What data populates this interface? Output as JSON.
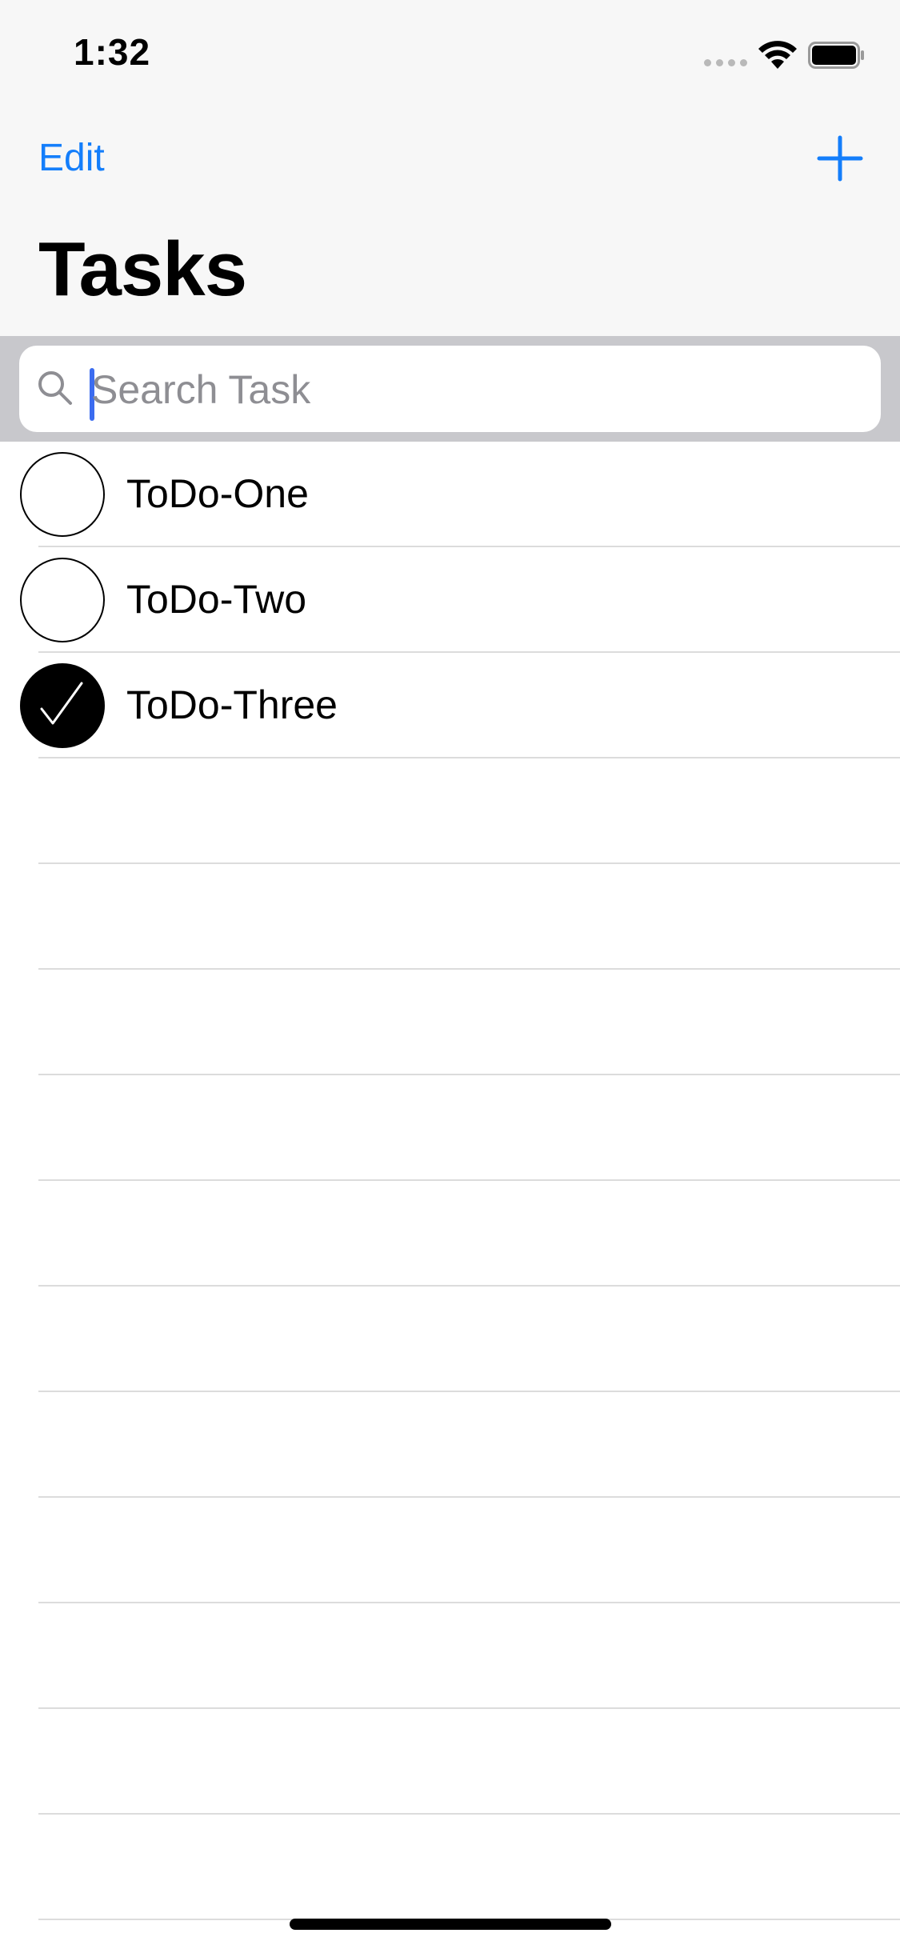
{
  "status_bar": {
    "time": "1:32"
  },
  "nav": {
    "edit_label": "Edit",
    "add_icon": "plus-icon",
    "title": "Tasks",
    "accent_color": "#147efb"
  },
  "search": {
    "placeholder": "Search Task",
    "value": ""
  },
  "tasks": [
    {
      "label": "ToDo-One",
      "completed": false
    },
    {
      "label": "ToDo-Two",
      "completed": false
    },
    {
      "label": "ToDo-Three",
      "completed": true
    }
  ]
}
